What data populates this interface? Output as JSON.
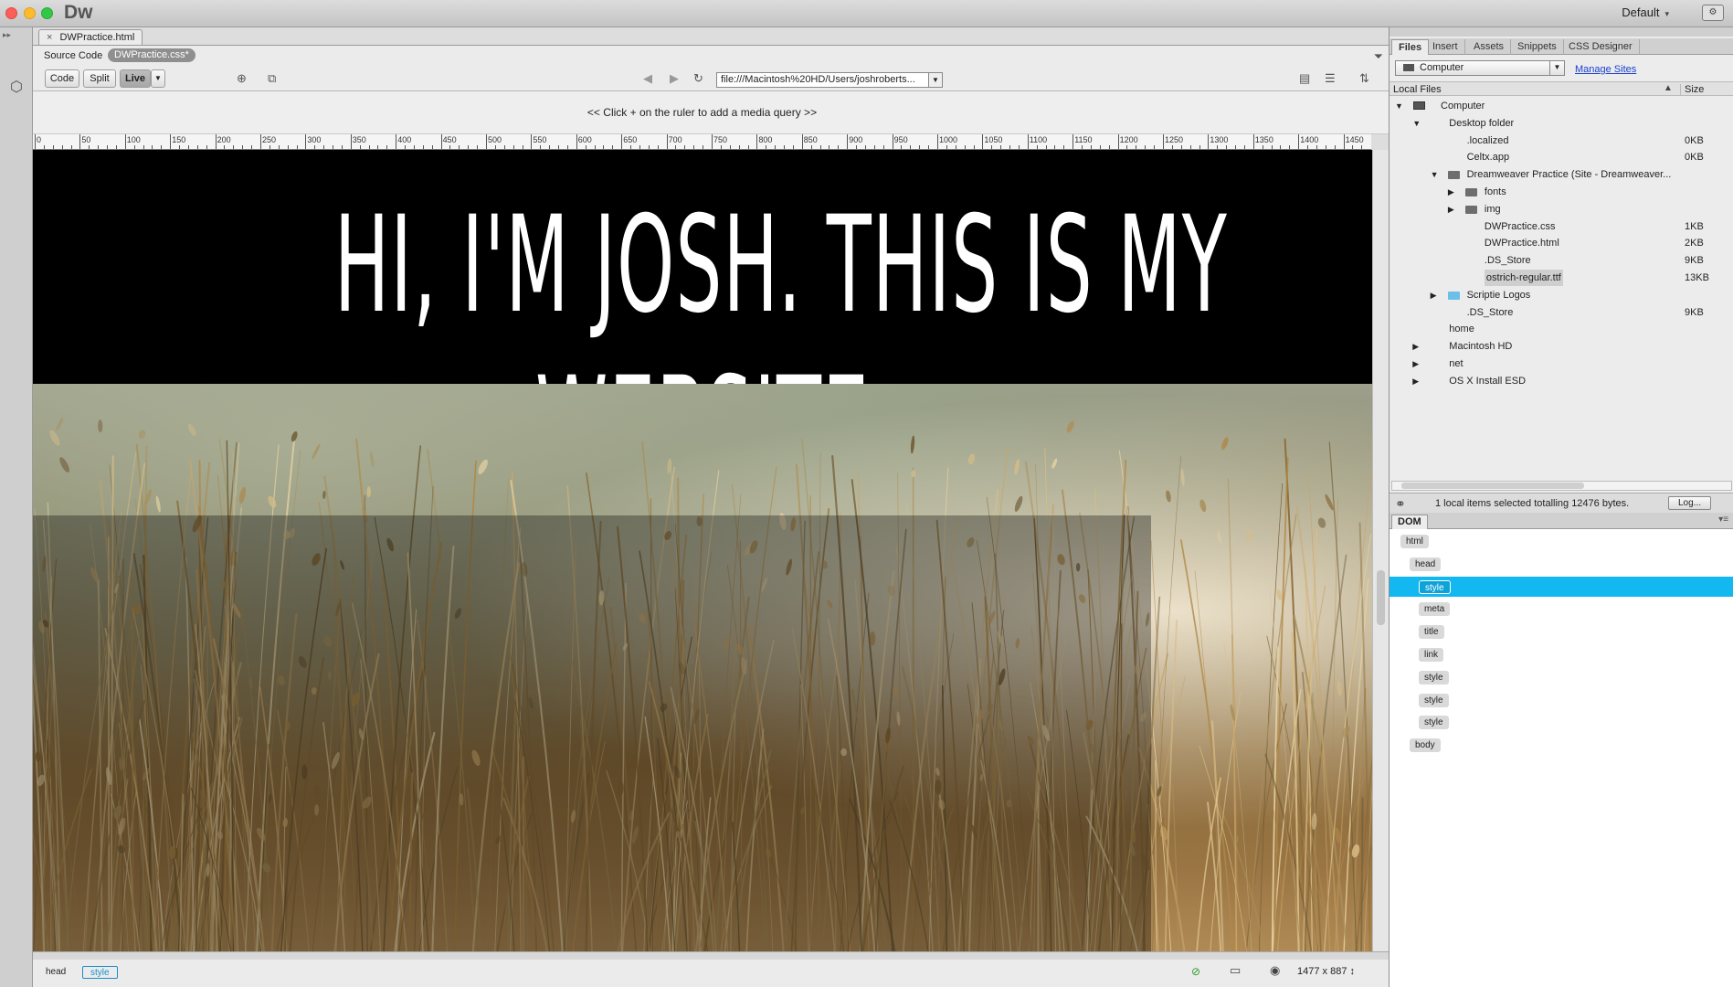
{
  "app": {
    "logo": "Dw",
    "workspace": "Default",
    "workspace_switch_icon": "workspace-switcher-icon"
  },
  "document": {
    "tab_name": "DWPractice.html",
    "related_label": "Source Code",
    "related_file": "DWPractice.css*",
    "views": {
      "code": "Code",
      "split": "Split",
      "live": "Live"
    },
    "url": "file:///Macintosh%20HD/Users/joshroberts...",
    "media_query_hint": "<< Click + on the ruler to add a media query >>",
    "ruler_labels": [
      "0",
      "50",
      "100",
      "150",
      "200",
      "250",
      "300",
      "350",
      "400",
      "450",
      "500",
      "550",
      "600",
      "650",
      "700",
      "750",
      "800",
      "850",
      "900",
      "950",
      "1000",
      "1050",
      "1100",
      "1150",
      "1200",
      "1250",
      "1300",
      "1350",
      "1400",
      "1450"
    ],
    "live_headline_line1": "HI, I'M JOSH. THIS IS MY",
    "live_headline_line2": "WEBSITE",
    "status_tags": [
      "head",
      "style"
    ],
    "dimensions": "1477 x 887 ↕"
  },
  "files_panel": {
    "tabs": [
      "Files",
      "Insert",
      "Assets",
      "Snippets",
      "CSS Designer"
    ],
    "active_tab": "Files",
    "site_select": "Computer",
    "manage_sites": "Manage Sites",
    "col_local": "Local Files",
    "col_size": "Size",
    "tree": [
      {
        "name": "Computer",
        "size": "",
        "level": 0,
        "twisty": "▼",
        "icon": "computer"
      },
      {
        "name": "Desktop folder",
        "size": "",
        "level": 1,
        "twisty": "▼",
        "icon": "none"
      },
      {
        "name": ".localized",
        "size": "0KB",
        "level": 2,
        "twisty": "",
        "icon": "none"
      },
      {
        "name": "Celtx.app",
        "size": "0KB",
        "level": 2,
        "twisty": "",
        "icon": "none"
      },
      {
        "name": "Dreamweaver Practice (Site - Dreamweaver...",
        "size": "",
        "level": 2,
        "twisty": "▼",
        "icon": "folder"
      },
      {
        "name": "fonts",
        "size": "",
        "level": 3,
        "twisty": "▶",
        "icon": "folder"
      },
      {
        "name": "img",
        "size": "",
        "level": 3,
        "twisty": "▶",
        "icon": "folder"
      },
      {
        "name": "DWPractice.css",
        "size": "1KB",
        "level": 3,
        "twisty": "",
        "icon": "none"
      },
      {
        "name": "DWPractice.html",
        "size": "2KB",
        "level": 3,
        "twisty": "",
        "icon": "none"
      },
      {
        "name": ".DS_Store",
        "size": "9KB",
        "level": 3,
        "twisty": "",
        "icon": "none"
      },
      {
        "name": "ostrich-regular.ttf",
        "size": "13KB",
        "level": 3,
        "twisty": "",
        "icon": "none",
        "selected": true
      },
      {
        "name": "Scriptie Logos",
        "size": "",
        "level": 2,
        "twisty": "▶",
        "icon": "folder-blue"
      },
      {
        "name": ".DS_Store",
        "size": "9KB",
        "level": 2,
        "twisty": "",
        "icon": "none"
      },
      {
        "name": "home",
        "size": "",
        "level": 1,
        "twisty": "",
        "icon": "none"
      },
      {
        "name": "Macintosh HD",
        "size": "",
        "level": 1,
        "twisty": "▶",
        "icon": "none"
      },
      {
        "name": "net",
        "size": "",
        "level": 1,
        "twisty": "▶",
        "icon": "none"
      },
      {
        "name": "OS X Install ESD",
        "size": "",
        "level": 1,
        "twisty": "▶",
        "icon": "none"
      }
    ],
    "status": "1 local items selected totalling 12476 bytes.",
    "log_button": "Log..."
  },
  "dom_panel": {
    "tab": "DOM",
    "nodes": [
      {
        "tag": "html",
        "level": 0
      },
      {
        "tag": "head",
        "level": 1
      },
      {
        "tag": "style",
        "level": 2,
        "selected": true
      },
      {
        "tag": "meta",
        "level": 2
      },
      {
        "tag": "title",
        "level": 2
      },
      {
        "tag": "link",
        "level": 2
      },
      {
        "tag": "style",
        "level": 2
      },
      {
        "tag": "style",
        "level": 2
      },
      {
        "tag": "style",
        "level": 2
      },
      {
        "tag": "body",
        "level": 1
      }
    ]
  }
}
